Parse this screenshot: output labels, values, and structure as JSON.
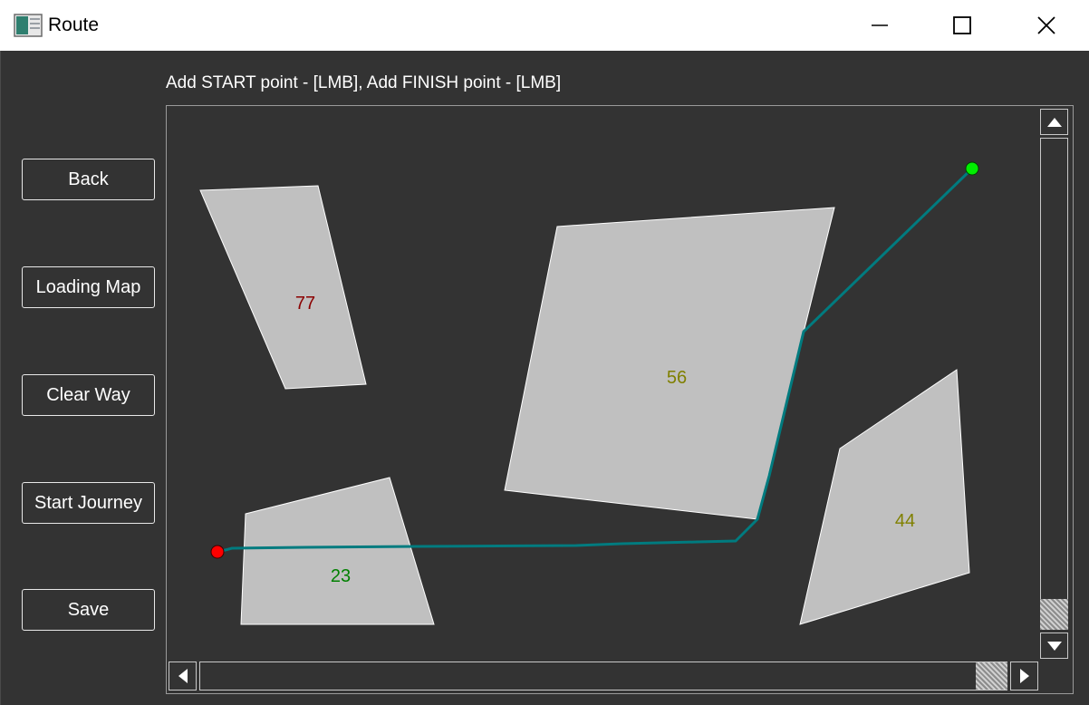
{
  "window": {
    "title": "Route",
    "icon": "app-window-icon",
    "controls": [
      "minimize-icon",
      "maximize-icon",
      "close-icon"
    ]
  },
  "hint": "Add START point - [LMB], Add FINISH point - [LMB]",
  "sidebar": {
    "buttons": [
      {
        "label": "Back"
      },
      {
        "label": "Loading Map"
      },
      {
        "label": "Clear Way"
      },
      {
        "label": "Start Journey"
      },
      {
        "label": "Save"
      }
    ]
  },
  "map": {
    "obstacles": [
      {
        "label": "77",
        "label_color": "#8b0000"
      },
      {
        "label": "56",
        "label_color": "#808000"
      },
      {
        "label": "44",
        "label_color": "#808000"
      },
      {
        "label": "23",
        "label_color": "#008000"
      }
    ],
    "start_point_color": "#ff0000",
    "finish_point_color": "#00ee00",
    "route_color": "#007b7f",
    "obstacle_fill": "#c0c0c0"
  },
  "scrollbars": {
    "vertical": {
      "up_icon": "arrow-up-icon",
      "down_icon": "arrow-down-icon"
    },
    "horizontal": {
      "left_icon": "arrow-left-icon",
      "right_icon": "arrow-right-icon"
    }
  }
}
